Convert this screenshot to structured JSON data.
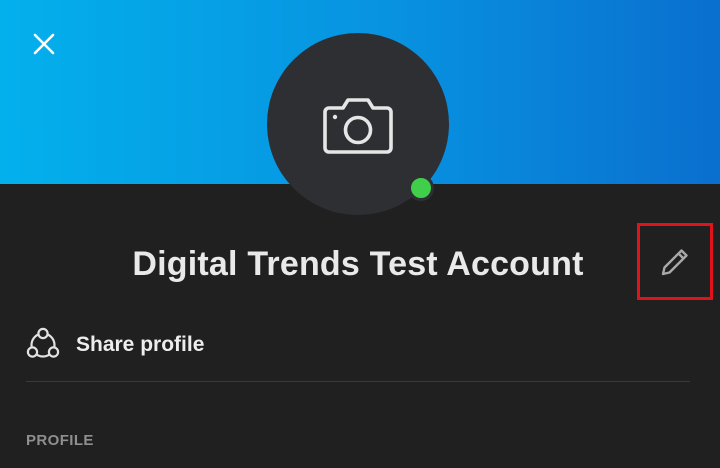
{
  "banner": {
    "gradient_start": "#03b0ec",
    "gradient_end": "#0a6fcf"
  },
  "header": {
    "close_icon": "close-icon"
  },
  "avatar": {
    "icon": "camera-icon",
    "presence_status": "online",
    "presence_color": "#3fcf4a"
  },
  "profile": {
    "display_name": "Digital Trends Test Account",
    "edit_icon": "pencil-icon",
    "highlight_color": "#e0121c"
  },
  "actions": {
    "share_label": "Share profile",
    "share_icon": "share-icon"
  },
  "sections": {
    "profile_label": "PROFILE"
  }
}
